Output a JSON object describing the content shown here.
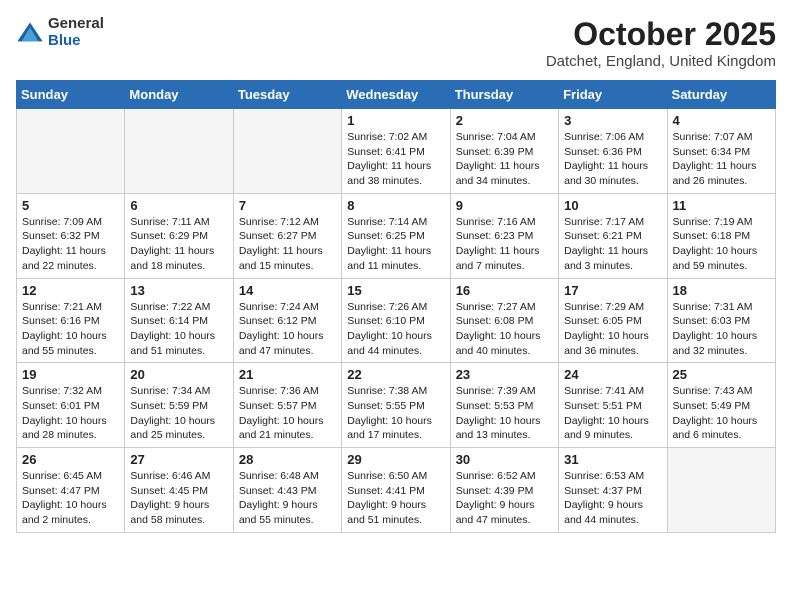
{
  "logo": {
    "general": "General",
    "blue": "Blue"
  },
  "title": "October 2025",
  "location": "Datchet, England, United Kingdom",
  "weekdays": [
    "Sunday",
    "Monday",
    "Tuesday",
    "Wednesday",
    "Thursday",
    "Friday",
    "Saturday"
  ],
  "weeks": [
    [
      {
        "day": "",
        "empty": true
      },
      {
        "day": "",
        "empty": true
      },
      {
        "day": "",
        "empty": true
      },
      {
        "day": "1",
        "sunrise": "7:02 AM",
        "sunset": "6:41 PM",
        "daylight": "11 hours and 38 minutes."
      },
      {
        "day": "2",
        "sunrise": "7:04 AM",
        "sunset": "6:39 PM",
        "daylight": "11 hours and 34 minutes."
      },
      {
        "day": "3",
        "sunrise": "7:06 AM",
        "sunset": "6:36 PM",
        "daylight": "11 hours and 30 minutes."
      },
      {
        "day": "4",
        "sunrise": "7:07 AM",
        "sunset": "6:34 PM",
        "daylight": "11 hours and 26 minutes."
      }
    ],
    [
      {
        "day": "5",
        "sunrise": "7:09 AM",
        "sunset": "6:32 PM",
        "daylight": "11 hours and 22 minutes."
      },
      {
        "day": "6",
        "sunrise": "7:11 AM",
        "sunset": "6:29 PM",
        "daylight": "11 hours and 18 minutes."
      },
      {
        "day": "7",
        "sunrise": "7:12 AM",
        "sunset": "6:27 PM",
        "daylight": "11 hours and 15 minutes."
      },
      {
        "day": "8",
        "sunrise": "7:14 AM",
        "sunset": "6:25 PM",
        "daylight": "11 hours and 11 minutes."
      },
      {
        "day": "9",
        "sunrise": "7:16 AM",
        "sunset": "6:23 PM",
        "daylight": "11 hours and 7 minutes."
      },
      {
        "day": "10",
        "sunrise": "7:17 AM",
        "sunset": "6:21 PM",
        "daylight": "11 hours and 3 minutes."
      },
      {
        "day": "11",
        "sunrise": "7:19 AM",
        "sunset": "6:18 PM",
        "daylight": "10 hours and 59 minutes."
      }
    ],
    [
      {
        "day": "12",
        "sunrise": "7:21 AM",
        "sunset": "6:16 PM",
        "daylight": "10 hours and 55 minutes."
      },
      {
        "day": "13",
        "sunrise": "7:22 AM",
        "sunset": "6:14 PM",
        "daylight": "10 hours and 51 minutes."
      },
      {
        "day": "14",
        "sunrise": "7:24 AM",
        "sunset": "6:12 PM",
        "daylight": "10 hours and 47 minutes."
      },
      {
        "day": "15",
        "sunrise": "7:26 AM",
        "sunset": "6:10 PM",
        "daylight": "10 hours and 44 minutes."
      },
      {
        "day": "16",
        "sunrise": "7:27 AM",
        "sunset": "6:08 PM",
        "daylight": "10 hours and 40 minutes."
      },
      {
        "day": "17",
        "sunrise": "7:29 AM",
        "sunset": "6:05 PM",
        "daylight": "10 hours and 36 minutes."
      },
      {
        "day": "18",
        "sunrise": "7:31 AM",
        "sunset": "6:03 PM",
        "daylight": "10 hours and 32 minutes."
      }
    ],
    [
      {
        "day": "19",
        "sunrise": "7:32 AM",
        "sunset": "6:01 PM",
        "daylight": "10 hours and 28 minutes."
      },
      {
        "day": "20",
        "sunrise": "7:34 AM",
        "sunset": "5:59 PM",
        "daylight": "10 hours and 25 minutes."
      },
      {
        "day": "21",
        "sunrise": "7:36 AM",
        "sunset": "5:57 PM",
        "daylight": "10 hours and 21 minutes."
      },
      {
        "day": "22",
        "sunrise": "7:38 AM",
        "sunset": "5:55 PM",
        "daylight": "10 hours and 17 minutes."
      },
      {
        "day": "23",
        "sunrise": "7:39 AM",
        "sunset": "5:53 PM",
        "daylight": "10 hours and 13 minutes."
      },
      {
        "day": "24",
        "sunrise": "7:41 AM",
        "sunset": "5:51 PM",
        "daylight": "10 hours and 9 minutes."
      },
      {
        "day": "25",
        "sunrise": "7:43 AM",
        "sunset": "5:49 PM",
        "daylight": "10 hours and 6 minutes."
      }
    ],
    [
      {
        "day": "26",
        "sunrise": "6:45 AM",
        "sunset": "4:47 PM",
        "daylight": "10 hours and 2 minutes."
      },
      {
        "day": "27",
        "sunrise": "6:46 AM",
        "sunset": "4:45 PM",
        "daylight": "9 hours and 58 minutes."
      },
      {
        "day": "28",
        "sunrise": "6:48 AM",
        "sunset": "4:43 PM",
        "daylight": "9 hours and 55 minutes."
      },
      {
        "day": "29",
        "sunrise": "6:50 AM",
        "sunset": "4:41 PM",
        "daylight": "9 hours and 51 minutes."
      },
      {
        "day": "30",
        "sunrise": "6:52 AM",
        "sunset": "4:39 PM",
        "daylight": "9 hours and 47 minutes."
      },
      {
        "day": "31",
        "sunrise": "6:53 AM",
        "sunset": "4:37 PM",
        "daylight": "9 hours and 44 minutes."
      },
      {
        "day": "",
        "empty": true
      }
    ]
  ],
  "labels": {
    "sunrise_prefix": "Sunrise: ",
    "sunset_prefix": "Sunset: ",
    "daylight_prefix": "Daylight: "
  }
}
